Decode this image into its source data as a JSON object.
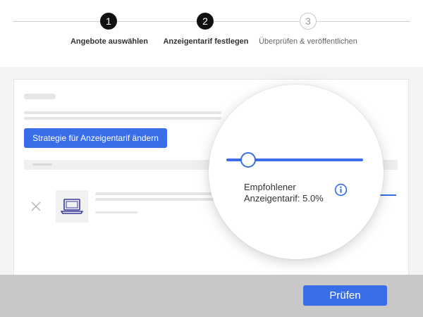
{
  "stepper": {
    "steps": [
      {
        "number": "1",
        "label": "Angebote auswählen",
        "state": "done"
      },
      {
        "number": "2",
        "label": "Anzeigentarif festlegen",
        "state": "active"
      },
      {
        "number": "3",
        "label": "Überprüfen & veröffentlichen",
        "state": "pending"
      }
    ]
  },
  "main": {
    "strategy_button_label": "Strategie für Anzeigentarif ändern",
    "listing": {
      "remove_icon": "close-icon",
      "thumbnail_icon": "laptop-icon"
    }
  },
  "magnifier": {
    "slider_value_percent": 5.0,
    "rate_label": "Empfohlener Anzeigentarif: 5.0%",
    "info_icon": "info-icon"
  },
  "footer": {
    "review_button_label": "Prüfen"
  },
  "colors": {
    "accent": "#3a6ee8",
    "step_active": "#111111",
    "footer_bg": "#c8c8c8"
  }
}
